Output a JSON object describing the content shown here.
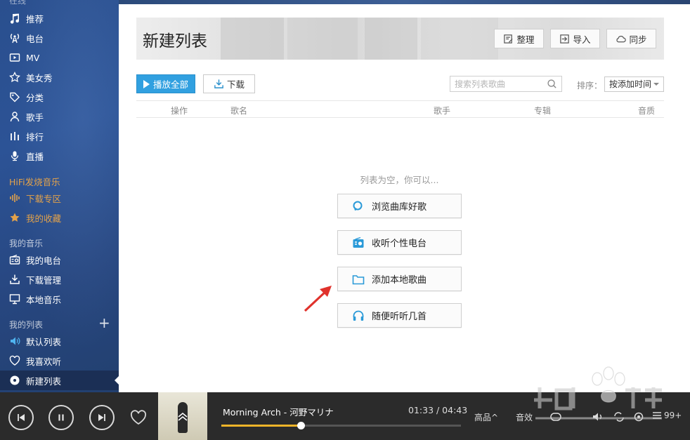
{
  "sidebar": {
    "cut_top": "在线",
    "items": [
      {
        "label": "推荐",
        "icon": "music-note-icon"
      },
      {
        "label": "电台",
        "icon": "radio-tower-icon"
      },
      {
        "label": "MV",
        "icon": "mv-play-icon"
      },
      {
        "label": "美女秀",
        "icon": "star-outline-icon"
      },
      {
        "label": "分类",
        "icon": "tag-icon"
      },
      {
        "label": "歌手",
        "icon": "person-icon"
      },
      {
        "label": "排行",
        "icon": "bars-chart-icon"
      },
      {
        "label": "直播",
        "icon": "microphone-icon"
      }
    ],
    "hifi_title": "HiFi发烧音乐",
    "hifi_items": [
      {
        "label": "下载专区",
        "icon": "waveform-icon"
      },
      {
        "label": "我的收藏",
        "icon": "star-filled-icon"
      }
    ],
    "my_music_title": "我的音乐",
    "my_music_items": [
      {
        "label": "我的电台",
        "icon": "radio-box-icon"
      },
      {
        "label": "下载管理",
        "icon": "download-tray-icon"
      },
      {
        "label": "本地音乐",
        "icon": "monitor-icon"
      }
    ],
    "my_lists_title": "我的列表",
    "add_list_symbol": "+",
    "list_items": [
      {
        "label": "默认列表",
        "icon": "speaker-icon"
      },
      {
        "label": "我喜欢听",
        "icon": "heart-icon"
      },
      {
        "label": "新建列表",
        "icon": "disc-icon",
        "active": true
      }
    ]
  },
  "banner": {
    "title": "新建列表",
    "organize_label": "整理",
    "import_label": "导入",
    "sync_label": "同步"
  },
  "toolbar": {
    "play_all_label": "播放全部",
    "download_label": "下载",
    "search_placeholder": "搜索列表歌曲",
    "sort_label": "排序：",
    "sort_value": "按添加时间"
  },
  "table": {
    "columns": [
      "操作",
      "歌名",
      "歌手",
      "专辑",
      "音质"
    ]
  },
  "empty_state": {
    "hint": "列表为空，你可以...",
    "actions": [
      {
        "label": "浏览曲库好歌",
        "icon": "search-icon"
      },
      {
        "label": "收听个性电台",
        "icon": "radio-icon"
      },
      {
        "label": "添加本地歌曲",
        "icon": "folder-icon"
      },
      {
        "label": "随便听听几首",
        "icon": "headphones-icon"
      }
    ]
  },
  "player": {
    "song": "Morning Arch - 河野マリナ",
    "time": "01:33 / 04:43",
    "progress": 0.33,
    "quality_label": "高品",
    "effects_label": "音效",
    "queue_count": "99+"
  },
  "colors": {
    "accent": "#31a0e0",
    "sidebar_bg": "#2c5396",
    "hifi": "#e3a24a",
    "progress": "#f0b429",
    "player_bg": "#2b2b2b",
    "arrow": "#e0322c"
  }
}
